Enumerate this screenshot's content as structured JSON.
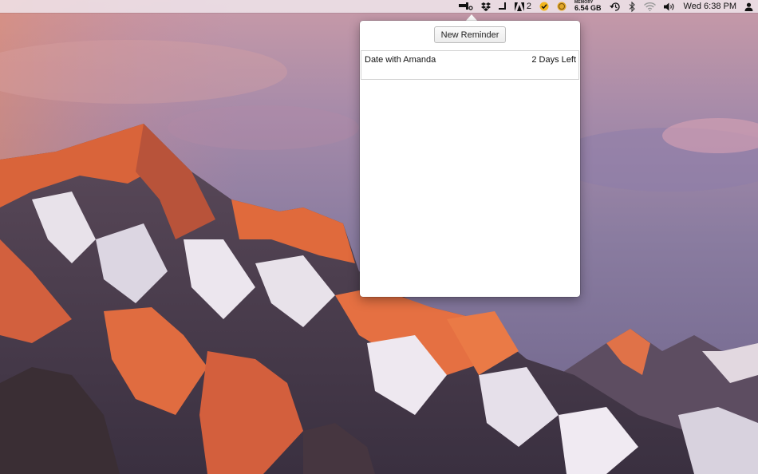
{
  "menubar": {
    "icons": [
      {
        "name": "reminder-app-icon"
      },
      {
        "name": "dropbox-icon"
      },
      {
        "name": "corner-bracket-icon"
      },
      {
        "name": "adobe-icon",
        "badge": "2"
      },
      {
        "name": "checkmark-badge-icon"
      },
      {
        "name": "coin-icon"
      }
    ],
    "memory_label": "MEMORY",
    "memory_value": "6.54 GB",
    "time_machine_icon": "time-machine-icon",
    "bluetooth_icon": "bluetooth-icon",
    "wifi_icon": "wifi-icon",
    "volume_icon": "volume-icon",
    "clock": "Wed 6:38 PM",
    "user_icon": "user-icon"
  },
  "popover": {
    "new_button_label": "New Reminder",
    "reminders": [
      {
        "title": "Date with Amanda",
        "remaining": "2 Days Left"
      }
    ]
  },
  "colors": {
    "menubar_bg": "#f0e8ee",
    "popover_bg": "#ffffff",
    "accent_orange": "#e0673a",
    "sky_purple": "#8d7aa0"
  }
}
